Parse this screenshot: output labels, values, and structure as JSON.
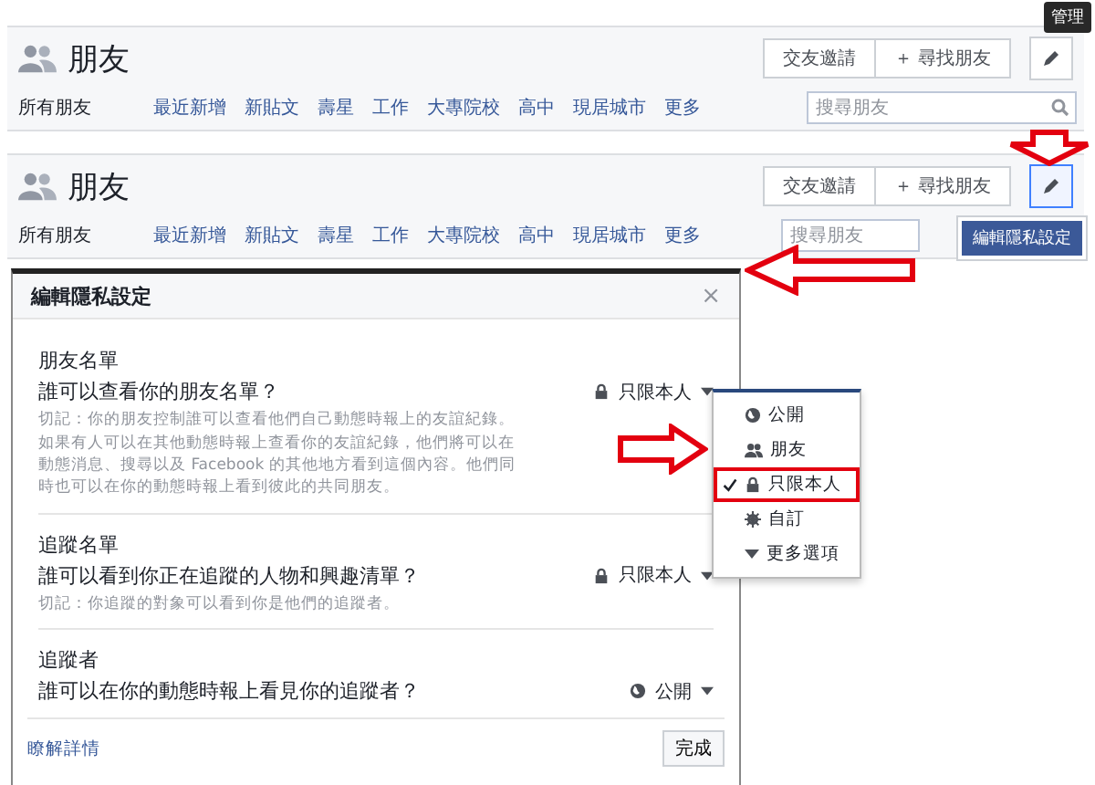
{
  "headers": [
    {
      "title": "朋友",
      "tooltip": "管理",
      "buttons": [
        "交友邀請",
        "＋ 尋找朋友"
      ],
      "edit_pressed": false,
      "nav": [
        {
          "label": "所有朋友",
          "selected": true
        },
        {
          "label": "最近新增",
          "selected": false
        },
        {
          "label": "新貼文",
          "selected": false
        },
        {
          "label": "壽星",
          "selected": false
        },
        {
          "label": "工作",
          "selected": false
        },
        {
          "label": "大專院校",
          "selected": false
        },
        {
          "label": "高中",
          "selected": false
        },
        {
          "label": "現居城市",
          "selected": false
        },
        {
          "label": "更多",
          "selected": false
        }
      ],
      "search": {
        "placeholder": "搜尋朋友"
      }
    },
    {
      "title": "朋友",
      "buttons": [
        "交友邀請",
        "＋ 尋找朋友"
      ],
      "edit_pressed": true,
      "menu": [
        "編輯隱私設定"
      ],
      "nav": [
        {
          "label": "所有朋友",
          "selected": true
        },
        {
          "label": "最近新增",
          "selected": false
        },
        {
          "label": "新貼文",
          "selected": false
        },
        {
          "label": "壽星",
          "selected": false
        },
        {
          "label": "工作",
          "selected": false
        },
        {
          "label": "大專院校",
          "selected": false
        },
        {
          "label": "高中",
          "selected": false
        },
        {
          "label": "現居城市",
          "selected": false
        },
        {
          "label": "更多",
          "selected": false
        }
      ],
      "search": {
        "placeholder": "搜尋朋友"
      }
    }
  ],
  "dialog": {
    "title": "編輯隱私設定",
    "close": "×",
    "sections": [
      {
        "heading": "朋友名單",
        "question": "誰可以查看你的朋友名單？",
        "note": "切記：你的朋友控制誰可以查看他們自己動態時報上的友誼紀錄。如果有人可以在其他動態時報上查看你的友誼紀錄，他們將可以在動態消息、搜尋以及 Facebook 的其他地方看到這個內容。他們同時也可以在你的動態時報上看到彼此的共同朋友。",
        "audience": {
          "kind": "lock",
          "label": "只限本人"
        }
      },
      {
        "heading": "追蹤名單",
        "question": "誰可以看到你正在追蹤的人物和興趣清單？",
        "note": "切記：你追蹤的對象可以看到你是他們的追蹤者。",
        "audience": {
          "kind": "lock",
          "label": "只限本人"
        }
      },
      {
        "heading": "追蹤者",
        "question": "誰可以在你的動態時報上看見你的追蹤者？",
        "audience": {
          "kind": "globe",
          "label": "公開"
        }
      }
    ],
    "link": "瞭解詳情",
    "done": "完成"
  },
  "audience_menu": [
    {
      "kind": "globe",
      "label": "公開",
      "selected": false,
      "highlighted": false
    },
    {
      "kind": "friends",
      "label": "朋友",
      "selected": false,
      "highlighted": false
    },
    {
      "kind": "lock",
      "label": "只限本人",
      "selected": true,
      "highlighted": true
    },
    {
      "kind": "gear",
      "label": "自訂",
      "selected": false,
      "highlighted": false
    },
    {
      "kind": "more",
      "label": "更多選項",
      "selected": false,
      "highlighted": false
    }
  ],
  "arrows": [
    {
      "kind": "down"
    },
    {
      "kind": "left"
    },
    {
      "kind": "right"
    }
  ]
}
